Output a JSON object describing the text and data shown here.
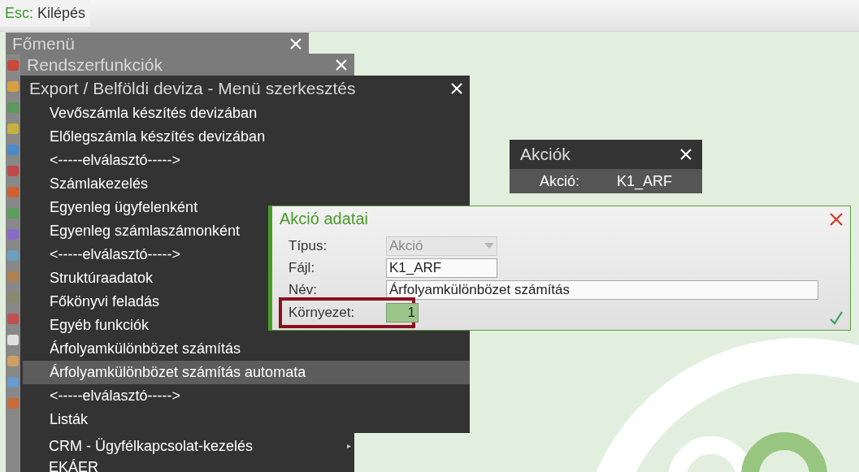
{
  "toolbar": {
    "key": "Esc:",
    "label": "Kilépés"
  },
  "main_menu": {
    "title": "Főmenü"
  },
  "system_functions": {
    "title": "Rendszerfunkciók",
    "items": [
      {
        "label": "CRM - Ügyfélkapcsolat-kezelés",
        "arrow": "▸"
      },
      {
        "label": "EKÁER"
      }
    ]
  },
  "menu_editor": {
    "title": "Export / Belföldi deviza - Menü szerkesztés",
    "items": [
      {
        "label": "Vevőszámla készítés devizában",
        "selected": false
      },
      {
        "label": "Előlegszámla készítés devizában",
        "selected": false
      },
      {
        "label": "<-----elválasztó----->",
        "selected": false
      },
      {
        "label": "Számlakezelés",
        "selected": false
      },
      {
        "label": "Egyenleg ügyfelenként",
        "selected": false
      },
      {
        "label": "Egyenleg számlaszámonként",
        "selected": false
      },
      {
        "label": "<-----elválasztó----->",
        "selected": false
      },
      {
        "label": "Struktúraadatok",
        "selected": false
      },
      {
        "label": "Főkönyvi feladás",
        "selected": false
      },
      {
        "label": "Egyéb funkciók",
        "selected": false
      },
      {
        "label": "Árfolyamkülönbözet számítás",
        "selected": false
      },
      {
        "label": "Árfolyamkülönbözet számítás automata",
        "selected": true
      },
      {
        "label": "<-----elválasztó----->",
        "selected": false
      },
      {
        "label": "Listák",
        "selected": false
      }
    ]
  },
  "actions": {
    "title": "Akciók",
    "label": "Akció:",
    "value": "K1_ARF"
  },
  "dialog": {
    "title": "Akció adatai",
    "fields": [
      {
        "kind": "select",
        "label": "Típus:",
        "value": "Akció",
        "disabled": true,
        "highlighted": false
      },
      {
        "kind": "text",
        "label": "Fájl:",
        "value": "K1_ARF",
        "disabled": false,
        "highlighted": false
      },
      {
        "kind": "long_text",
        "label": "Név:",
        "value": "Árfolyamkülönbözet számítás",
        "disabled": false,
        "highlighted": false
      },
      {
        "kind": "number",
        "label": "Környezet:",
        "value": "1",
        "disabled": false,
        "highlighted": true
      }
    ]
  }
}
